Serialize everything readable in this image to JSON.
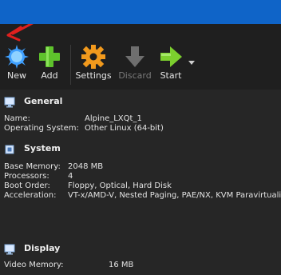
{
  "toolbar": {
    "buttons": [
      {
        "id": "new",
        "label": "New",
        "icon": "new-sun-icon",
        "enabled": true
      },
      {
        "id": "add",
        "label": "Add",
        "icon": "plus-icon",
        "enabled": true
      },
      {
        "id": "settings",
        "label": "Settings",
        "icon": "gear-icon",
        "enabled": true
      },
      {
        "id": "discard",
        "label": "Discard",
        "icon": "discard-arrow-icon",
        "enabled": false
      },
      {
        "id": "start",
        "label": "Start",
        "icon": "start-arrow-icon",
        "enabled": true
      }
    ]
  },
  "sections": {
    "general": {
      "title": "General",
      "rows": [
        {
          "key": "Name:",
          "value": "Alpine_LXQt_1"
        },
        {
          "key": "Operating System:",
          "value": "Other Linux (64-bit)"
        }
      ]
    },
    "system": {
      "title": "System",
      "rows": [
        {
          "key": "Base Memory:",
          "value": "2048 MB"
        },
        {
          "key": "Processors:",
          "value": "4"
        },
        {
          "key": "Boot Order:",
          "value": "Floppy, Optical, Hard Disk"
        },
        {
          "key": "Acceleration:",
          "value": "VT-x/AMD-V, Nested Paging, PAE/NX, KVM Paravirtualization"
        }
      ]
    },
    "display": {
      "title": "Display",
      "rows": [
        {
          "key": "Video Memory:",
          "value": "16 MB"
        }
      ]
    }
  },
  "colors": {
    "titlebar": "#0f64c8",
    "annotation_arrow": "#e0201e",
    "new_icon": "#3fa0ff",
    "add_icon": "#5ec22c",
    "settings_icon": "#f29a1d",
    "start_icon": "#7ccf2e"
  }
}
